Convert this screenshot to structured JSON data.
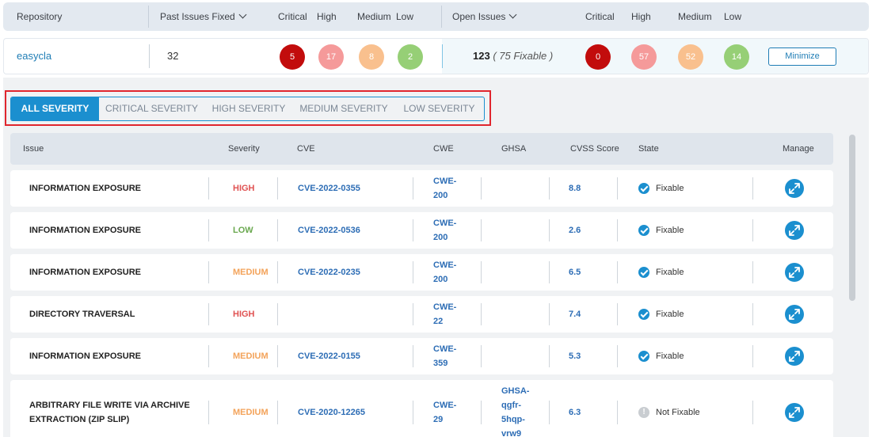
{
  "summary_header": {
    "repository": "Repository",
    "past_issues_fixed": "Past Issues Fixed",
    "critical": "Critical",
    "high": "High",
    "medium": "Medium",
    "low": "Low",
    "open_issues": "Open Issues",
    "critical2": "Critical",
    "high2": "High",
    "medium2": "Medium",
    "low2": "Low"
  },
  "repo": {
    "name": "easycla",
    "past_fixed": "32",
    "past_critical": "5",
    "past_high": "17",
    "past_medium": "8",
    "past_low": "2",
    "open_count": "123",
    "open_fixable": "( 75 Fixable )",
    "open_critical": "0",
    "open_high": "57",
    "open_medium": "52",
    "open_low": "14",
    "minimize_label": "Minimize"
  },
  "severity_tabs": [
    "ALL SEVERITY",
    "CRITICAL SEVERITY",
    "HIGH SEVERITY",
    "MEDIUM SEVERITY",
    "LOW SEVERITY"
  ],
  "table_header": {
    "issue": "Issue",
    "severity": "Severity",
    "cve": "CVE",
    "cwe": "CWE",
    "ghsa": "GHSA",
    "cvss": "CVSS Score",
    "state": "State",
    "manage": "Manage"
  },
  "rows": [
    {
      "issue": "INFORMATION EXPOSURE",
      "severity": "HIGH",
      "cve": "CVE-2022-0355",
      "cwe": "CWE-\n200",
      "ghsa": "",
      "cvss": "8.8",
      "state": "Fixable"
    },
    {
      "issue": "INFORMATION EXPOSURE",
      "severity": "LOW",
      "cve": "CVE-2022-0536",
      "cwe": "CWE-\n200",
      "ghsa": "",
      "cvss": "2.6",
      "state": "Fixable"
    },
    {
      "issue": "INFORMATION EXPOSURE",
      "severity": "MEDIUM",
      "cve": "CVE-2022-0235",
      "cwe": "CWE-\n200",
      "ghsa": "",
      "cvss": "6.5",
      "state": "Fixable"
    },
    {
      "issue": "DIRECTORY TRAVERSAL",
      "severity": "HIGH",
      "cve": "",
      "cwe": "CWE-\n22",
      "ghsa": "",
      "cvss": "7.4",
      "state": "Fixable"
    },
    {
      "issue": "INFORMATION EXPOSURE",
      "severity": "MEDIUM",
      "cve": "CVE-2022-0155",
      "cwe": "CWE-\n359",
      "ghsa": "",
      "cvss": "5.3",
      "state": "Fixable"
    },
    {
      "issue": "ARBITRARY FILE WRITE VIA ARCHIVE\nEXTRACTION (ZIP SLIP)",
      "severity": "MEDIUM",
      "cve": "CVE-2020-12265",
      "cwe": "CWE-\n29",
      "ghsa": "GHSA-\nqgfr-\n5hqp-\nvrw9",
      "cvss": "6.3",
      "state": "Not Fixable"
    }
  ]
}
